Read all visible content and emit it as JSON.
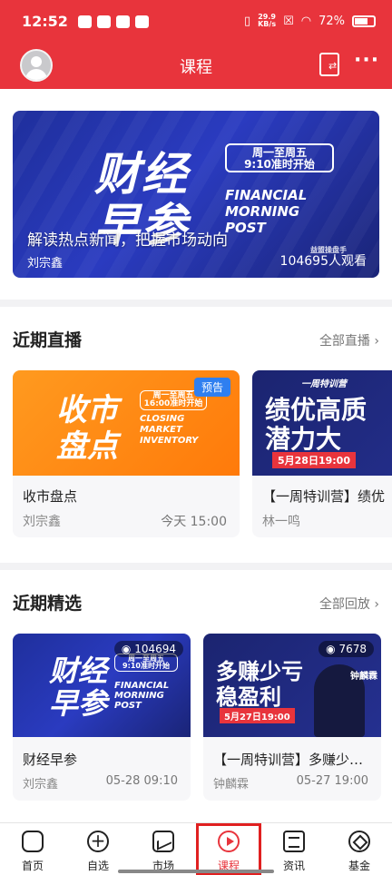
{
  "status_bar": {
    "time": "12:52",
    "net_speed_value": "29.9",
    "net_speed_unit": "KB/s",
    "battery": "72%"
  },
  "header": {
    "title": "课程"
  },
  "banner": {
    "art_line1": "财经",
    "art_line2": "早参",
    "schedule_line1": "周一至周五",
    "schedule_line2": "9:10准时开始",
    "english_line1": "FINANCIAL",
    "english_line2": "MORNING",
    "english_line3": "POST",
    "headline": "解读热点新闻，把握市场动向",
    "host": "刘宗鑫",
    "views": "104695人观看",
    "brand": "益盟操盘手"
  },
  "live_section": {
    "title": "近期直播",
    "more": "全部直播 ›",
    "cards": [
      {
        "art_line1": "收市",
        "art_line2": "盘点",
        "schedule": "周一至周五",
        "schedule2": "16:00准时开始",
        "english": "CLOSING MARKET INVENTORY",
        "badge": "预告",
        "name": "收市盘点",
        "host": "刘宗鑫",
        "time": "今天 15:00"
      },
      {
        "art_line1": "绩优高质",
        "art_line2": "潜力大",
        "topbrand": "一周特训营",
        "date": "5月28日19:00",
        "name": "【一周特训营】绩优",
        "host": "林一鸣"
      }
    ]
  },
  "picks_section": {
    "title": "近期精选",
    "more": "全部回放 ›",
    "cards": [
      {
        "art_line1": "财经",
        "art_line2": "早参",
        "views": "104694",
        "schedule": "周一至周五",
        "schedule2": "9:10准时开始",
        "english_line1": "FINANCIAL",
        "english_line2": "MORNING",
        "english_line3": "POST",
        "name": "财经早参",
        "host": "刘宗鑫",
        "time": "05-28 09:10"
      },
      {
        "art_line1": "多赚少亏",
        "art_line2": "稳盈利",
        "views": "7678",
        "presenter": "钟麟霖",
        "date": "5月27日19:00",
        "name": "【一周特训营】多赚少…",
        "host": "钟麟霖",
        "time": "05-27 19:00"
      }
    ]
  },
  "nav": {
    "items": [
      {
        "label": "首页",
        "icon": "home-icon"
      },
      {
        "label": "自选",
        "icon": "plus-circle-icon"
      },
      {
        "label": "市场",
        "icon": "chart-icon"
      },
      {
        "label": "课程",
        "icon": "play-circle-icon",
        "active": true
      },
      {
        "label": "资讯",
        "icon": "news-icon"
      },
      {
        "label": "基金",
        "icon": "fund-icon"
      }
    ]
  },
  "colors": {
    "brand_red": "#e8343c",
    "badge_blue": "#2f7ff0"
  }
}
